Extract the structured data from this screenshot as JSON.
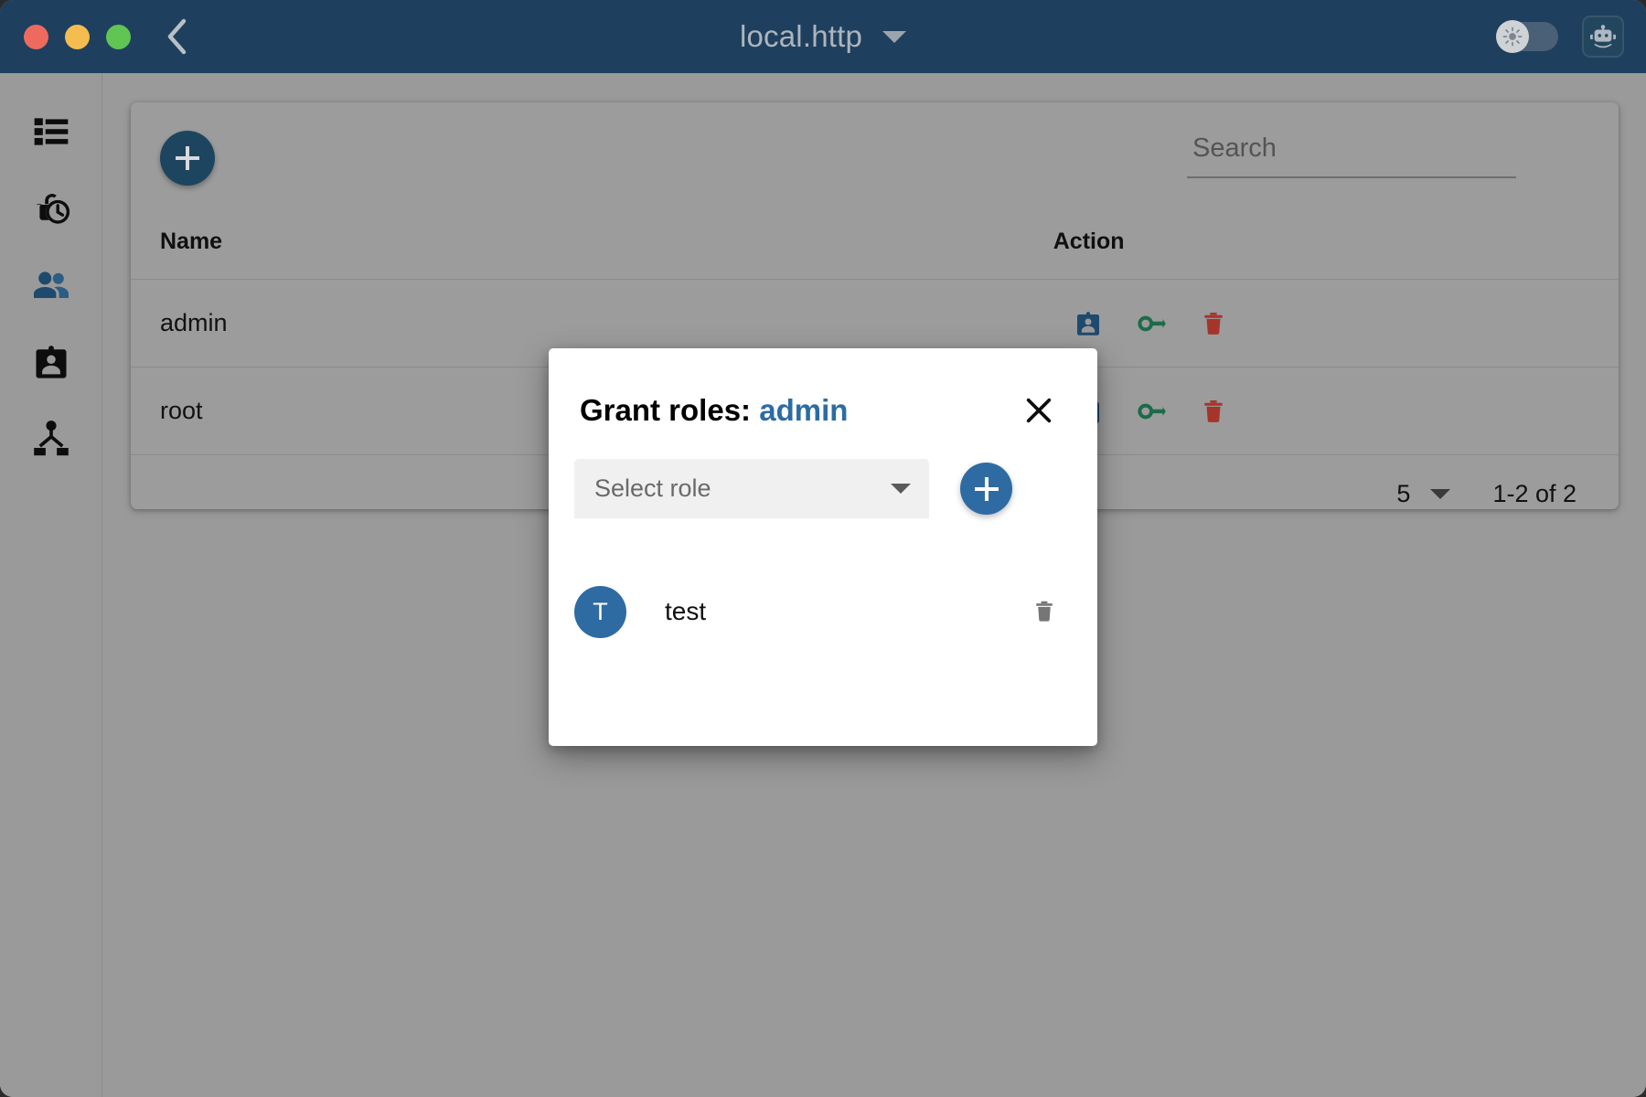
{
  "window": {
    "title": "local.http",
    "traffic_lights": [
      "close",
      "minimize",
      "maximize"
    ],
    "back_icon": "chevron-left-icon",
    "title_caret_icon": "chevron-down-icon",
    "theme_toggle_icon": "sun-icon",
    "theme_toggle_state": "off",
    "bot_icon": "robot-icon"
  },
  "sidebar": {
    "items": [
      {
        "name": "list",
        "icon": "list-icon",
        "active": false
      },
      {
        "name": "sessions",
        "icon": "lock-clock-icon",
        "active": false
      },
      {
        "name": "users",
        "icon": "people-icon",
        "active": true
      },
      {
        "name": "roles",
        "icon": "badge-icon",
        "active": false
      },
      {
        "name": "hierarchy",
        "icon": "account-tree-icon",
        "active": false
      }
    ]
  },
  "toolbar": {
    "add_button_label": "+",
    "add_icon": "plus-icon",
    "refresh_icon": "refresh-icon",
    "search": {
      "placeholder": "Search",
      "value": ""
    }
  },
  "table": {
    "columns": [
      "Name",
      "Action"
    ],
    "rows": [
      {
        "name": "admin",
        "actions": [
          {
            "name": "profile",
            "icon": "badge-icon",
            "color": "#1e4a6e"
          },
          {
            "name": "grant-roles",
            "icon": "key-icon",
            "color": "#1c6b4a"
          },
          {
            "name": "delete",
            "icon": "trash-icon",
            "color": "#a5352b"
          }
        ]
      },
      {
        "name": "root",
        "actions": [
          {
            "name": "profile",
            "icon": "badge-icon",
            "color": "#1e4a6e"
          },
          {
            "name": "grant-roles",
            "icon": "key-icon",
            "color": "#1c6b4a"
          },
          {
            "name": "delete",
            "icon": "trash-icon",
            "color": "#a5352b"
          }
        ]
      }
    ]
  },
  "paginator": {
    "page_size": "5",
    "page_size_caret_icon": "chevron-down-icon",
    "range_label": "1-2 of 2"
  },
  "modal": {
    "title_prefix": "Grant roles:",
    "subject": "admin",
    "close_icon": "close-icon",
    "role_select": {
      "placeholder": "Select role",
      "value": "",
      "caret_icon": "chevron-down-icon"
    },
    "add_role_icon": "plus-icon",
    "granted_roles": [
      {
        "initial": "T",
        "name": "test",
        "delete_icon": "trash-icon"
      }
    ]
  },
  "colors": {
    "titlebar": "#1e405e",
    "accent_dark_blue": "#1e455f",
    "accent_blue": "#2f6ba3",
    "link_blue": "#2c6ca3",
    "page_background": "#9a9a9a",
    "card_background": "#9c9c9c",
    "modal_background": "#ffffff",
    "key_green": "#1c6b4a",
    "delete_red": "#a5352b"
  }
}
